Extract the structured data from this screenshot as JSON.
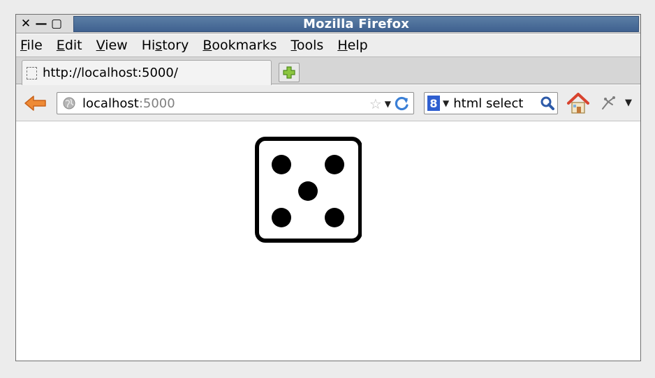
{
  "window": {
    "title": "Mozilla Firefox",
    "controls": {
      "close": "✕",
      "minimize": "—",
      "maximize": "▢"
    }
  },
  "menu": [
    {
      "prefix": "",
      "accel": "F",
      "rest": "ile"
    },
    {
      "prefix": "",
      "accel": "E",
      "rest": "dit"
    },
    {
      "prefix": "",
      "accel": "V",
      "rest": "iew"
    },
    {
      "prefix": "Hi",
      "accel": "s",
      "rest": "tory"
    },
    {
      "prefix": "",
      "accel": "B",
      "rest": "ookmarks"
    },
    {
      "prefix": "",
      "accel": "T",
      "rest": "ools"
    },
    {
      "prefix": "",
      "accel": "H",
      "rest": "elp"
    }
  ],
  "tab": {
    "title": "http://localhost:5000/"
  },
  "urlbar": {
    "host": "localhost",
    "port": ":5000"
  },
  "search": {
    "engine": "8",
    "value": "html select"
  },
  "page": {
    "die_face": 5
  },
  "icons": {
    "back": "back-arrow-icon",
    "globe": "globe-icon",
    "star": "bookmark-star-icon",
    "reload": "reload-icon",
    "search": "magnifier-icon",
    "home": "home-icon",
    "addon": "addon-icon",
    "newtab": "plus-icon"
  },
  "colors": {
    "titlebar": "#4a6d98",
    "back_arrow": "#e8842f",
    "home_roof": "#d8432e"
  }
}
